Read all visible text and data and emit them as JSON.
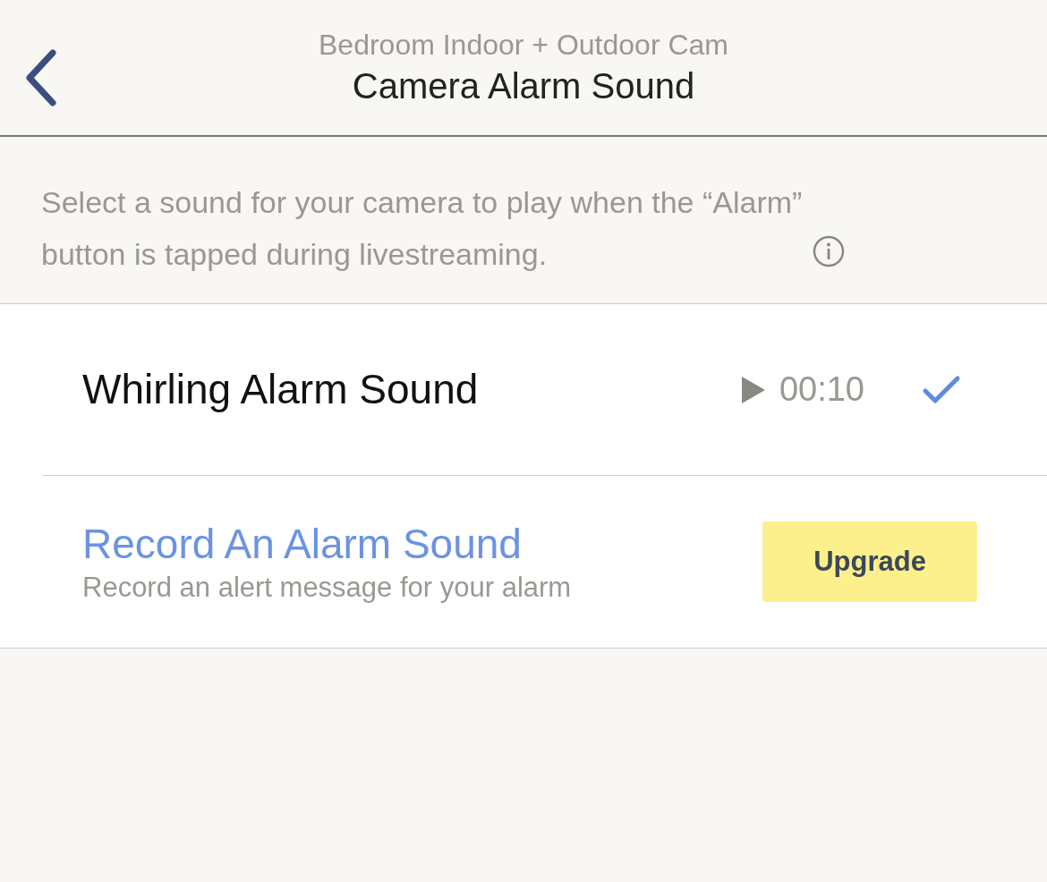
{
  "header": {
    "subtitle": "Bedroom Indoor + Outdoor Cam",
    "title": "Camera Alarm Sound"
  },
  "description": "Select a sound for your camera to play when the “Alarm” button is tapped during livestreaming.",
  "sounds": [
    {
      "kind": "sound",
      "name": "Whirling Alarm Sound",
      "duration": "00:10",
      "selected": true
    },
    {
      "kind": "record",
      "name": "Record An Alarm Sound",
      "detail": "Record an alert message for your alarm",
      "button": "Upgrade"
    }
  ]
}
